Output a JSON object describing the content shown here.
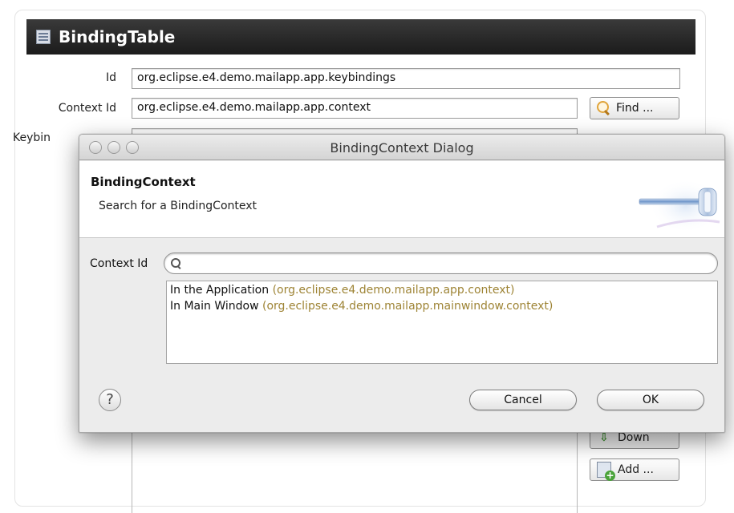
{
  "editor": {
    "title": "BindingTable",
    "id_label": "Id",
    "id_value": "org.eclipse.e4.demo.mailapp.app.keybindings",
    "context_label": "Context Id",
    "context_value": "org.eclipse.e4.demo.mailapp.app.context",
    "find_label": "Find ...",
    "keybindings_label": "Keybin",
    "down_label": "Down",
    "add_label": "Add ..."
  },
  "dialog": {
    "window_title": "BindingContext Dialog",
    "header_title": "BindingContext",
    "header_description": "Search for a BindingContext",
    "context_label": "Context Id",
    "search_value": "",
    "results": [
      {
        "name": "In the Application",
        "id": "(org.eclipse.e4.demo.mailapp.app.context)"
      },
      {
        "name": "In Main Window",
        "id": "(org.eclipse.e4.demo.mailapp.mainwindow.context)"
      }
    ],
    "help_label": "?",
    "cancel_label": "Cancel",
    "ok_label": "OK"
  },
  "colors": {
    "header_bar": "#1b1b1b",
    "context_id_text": "#9e8435",
    "dialog_bg": "#ececec"
  },
  "icons": {
    "editor_title": "table-icon",
    "find": "magnifier-icon",
    "search": "search-icon",
    "help": "help-icon",
    "header_graphic": "key-graphic",
    "down": "arrow-down-icon",
    "add": "add-icon"
  }
}
